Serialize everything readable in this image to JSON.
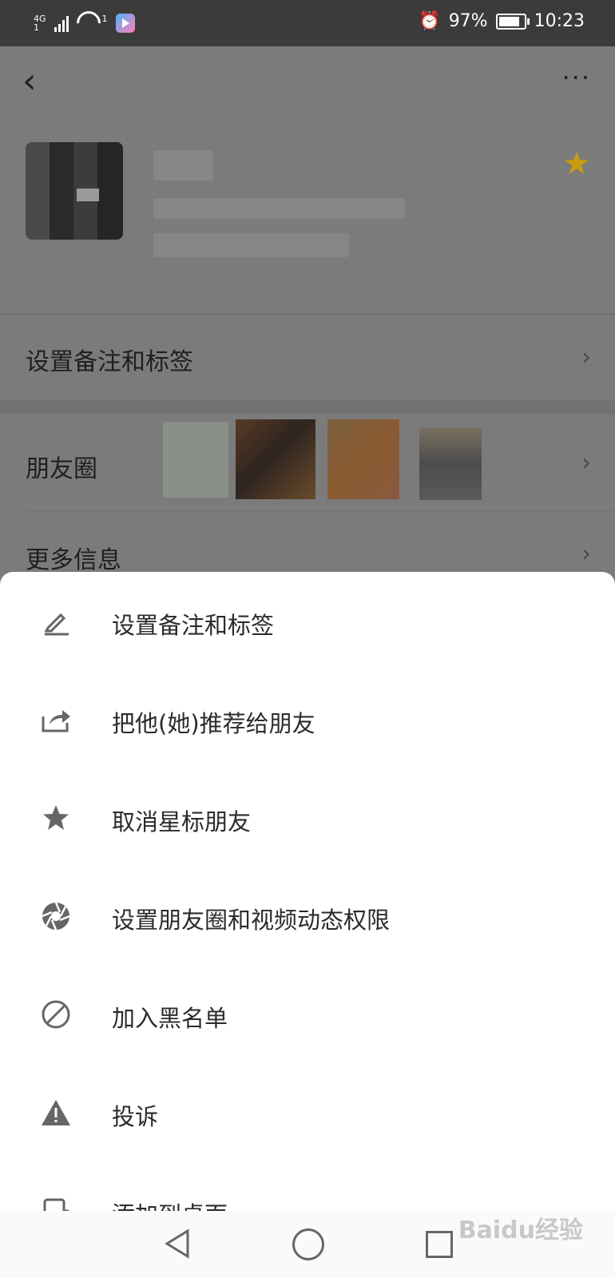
{
  "status_bar": {
    "network": "4G",
    "signal_sub": "1",
    "hotspot_sub": "1",
    "battery": "97%",
    "battery_level": 0.97,
    "time": "10:23"
  },
  "profile": {
    "starred": true,
    "star_color": "#c89b10"
  },
  "rows": {
    "remark_tags": "设置备注和标签",
    "moments": "朋友圈",
    "more_info": "更多信息"
  },
  "sheet": {
    "items": [
      {
        "label": "设置备注和标签",
        "icon": "pencil-icon"
      },
      {
        "label": "把他(她)推荐给朋友",
        "icon": "share-icon"
      },
      {
        "label": "取消星标朋友",
        "icon": "star-icon"
      },
      {
        "label": "设置朋友圈和视频动态权限",
        "icon": "aperture-icon"
      },
      {
        "label": "加入黑名单",
        "icon": "block-icon"
      },
      {
        "label": "投诉",
        "icon": "warning-icon"
      },
      {
        "label": "添加到桌面",
        "icon": "add-to-desktop-icon"
      }
    ]
  },
  "watermark": "Baidu经验"
}
